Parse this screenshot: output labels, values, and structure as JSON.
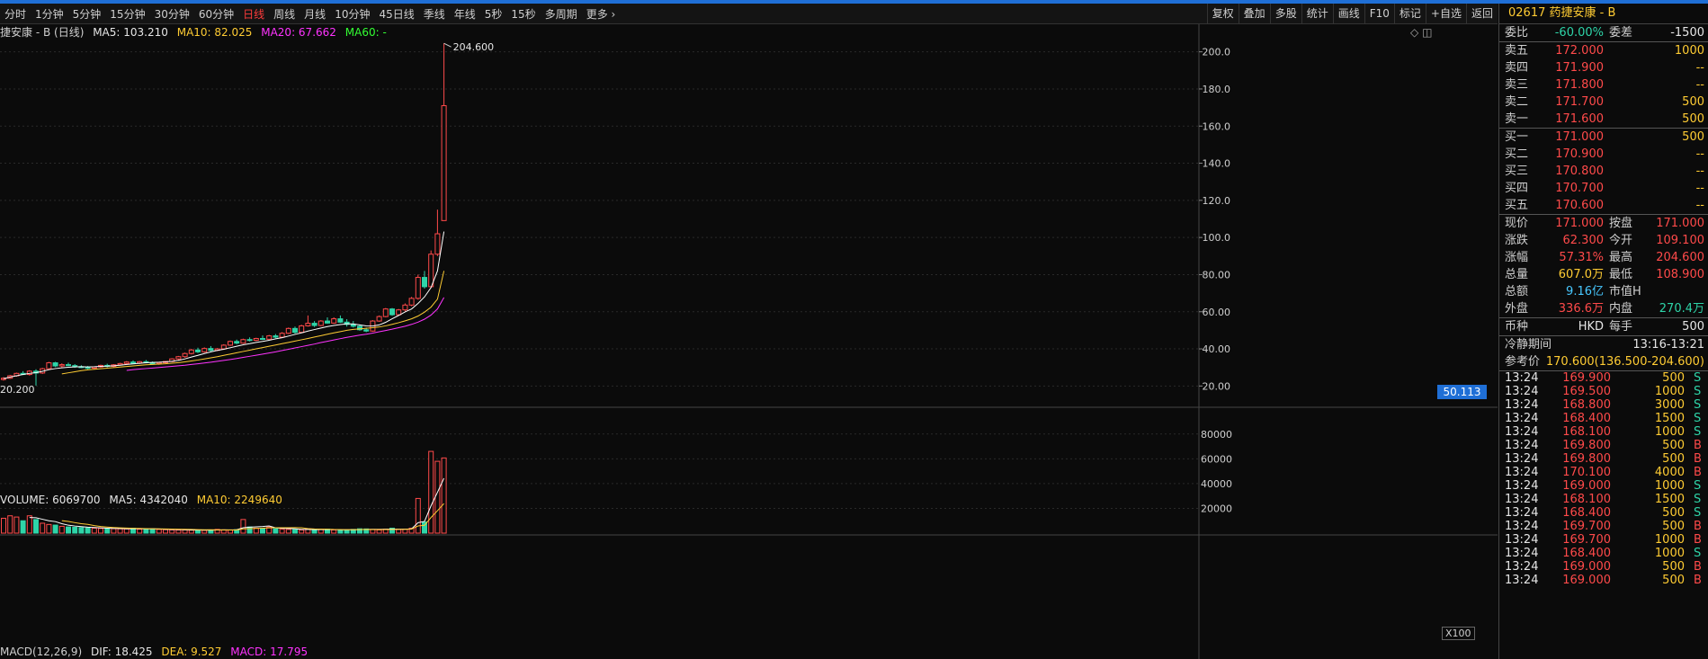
{
  "toolbar": {
    "left": [
      "分时",
      "1分钟",
      "5分钟",
      "15分钟",
      "30分钟",
      "60分钟",
      "日线",
      "周线",
      "月线",
      "10分钟",
      "45日线",
      "季线",
      "年线",
      "5秒",
      "15秒",
      "多周期",
      "更多 ›"
    ],
    "active": "日线",
    "right": [
      "复权",
      "叠加",
      "多股",
      "统计",
      "画线",
      "F10",
      "标记",
      "+自选",
      "返回"
    ]
  },
  "info": {
    "name": "捷安康 - B (日线)",
    "ma5": "MA5: 103.210",
    "ma10": "MA10: 82.025",
    "ma20": "MA20: 67.662",
    "ma60": "MA60: -"
  },
  "volume_info": {
    "vol": "VOLUME: 6069700",
    "ma5": "MA5: 4342040",
    "ma10": "MA10: 2249640"
  },
  "macd_info": {
    "label": "MACD(12,26,9)",
    "dif": "DIF: 18.425",
    "dea": "DEA: 9.527",
    "macd": "MACD: 17.795"
  },
  "colors": {
    "up": "#ff4a4a",
    "down": "#2ed4a8",
    "ma5": "#ffffff",
    "ma10": "#ffcc33",
    "ma20": "#ff33ff",
    "ma60": "#33ff33",
    "accent": "#1f6fd6"
  },
  "chart_data": {
    "type": "candlestick",
    "price_axis": {
      "ticks": [
        "200.0",
        "180.0",
        "160.0",
        "140.0",
        "120.0",
        "100.0",
        "80.00",
        "60.00",
        "40.00",
        "20.00"
      ],
      "ylim": [
        10,
        210
      ]
    },
    "high_label": "204.600",
    "low_label": "20.200",
    "current_price_label": "50.113",
    "volume_axis": {
      "ticks": [
        "80000",
        "60000",
        "40000",
        "20000"
      ],
      "ylim": [
        0,
        90000
      ],
      "unit": "X100"
    },
    "candles": [
      [
        23.5,
        24.8,
        22.9,
        24.2
      ],
      [
        24.2,
        26.0,
        23.8,
        25.5
      ],
      [
        25.5,
        27.2,
        25.0,
        26.8
      ],
      [
        26.8,
        28.0,
        25.9,
        26.2
      ],
      [
        26.2,
        28.5,
        25.6,
        28.0
      ],
      [
        28.0,
        29.0,
        20.2,
        27.0
      ],
      [
        27.0,
        29.8,
        26.5,
        29.3
      ],
      [
        29.3,
        33.0,
        28.8,
        32.5
      ],
      [
        32.5,
        33.0,
        30.2,
        30.8
      ],
      [
        30.8,
        32.2,
        30.0,
        31.5
      ],
      [
        31.5,
        32.6,
        30.7,
        31.0
      ],
      [
        31.0,
        31.8,
        29.8,
        30.4
      ],
      [
        30.4,
        31.2,
        29.6,
        30.0
      ],
      [
        30.0,
        30.8,
        29.0,
        29.6
      ],
      [
        29.6,
        30.6,
        29.0,
        30.3
      ],
      [
        30.3,
        31.5,
        29.8,
        31.1
      ],
      [
        31.1,
        32.0,
        30.0,
        30.6
      ],
      [
        30.6,
        31.8,
        30.2,
        31.4
      ],
      [
        31.4,
        32.5,
        31.0,
        32.1
      ],
      [
        32.1,
        33.4,
        31.6,
        32.9
      ],
      [
        32.9,
        33.8,
        31.9,
        32.3
      ],
      [
        32.3,
        33.5,
        31.8,
        33.1
      ],
      [
        33.1,
        34.0,
        32.2,
        32.6
      ],
      [
        32.6,
        33.2,
        31.5,
        32.0
      ],
      [
        32.0,
        33.0,
        31.4,
        32.6
      ],
      [
        32.6,
        33.5,
        32.0,
        33.2
      ],
      [
        33.2,
        35.0,
        32.8,
        34.6
      ],
      [
        34.6,
        36.2,
        34.0,
        35.8
      ],
      [
        35.8,
        38.0,
        35.2,
        37.5
      ],
      [
        37.5,
        40.0,
        37.0,
        39.4
      ],
      [
        39.4,
        40.6,
        37.8,
        38.4
      ],
      [
        38.4,
        40.8,
        38.0,
        40.2
      ],
      [
        40.2,
        41.5,
        38.6,
        39.2
      ],
      [
        39.2,
        40.5,
        38.8,
        40.0
      ],
      [
        40.0,
        42.5,
        39.5,
        42.0
      ],
      [
        42.0,
        44.5,
        41.6,
        44.0
      ],
      [
        44.0,
        45.0,
        42.5,
        43.1
      ],
      [
        43.1,
        45.5,
        42.8,
        45.0
      ],
      [
        45.0,
        46.2,
        44.0,
        44.6
      ],
      [
        44.6,
        46.0,
        44.2,
        45.6
      ],
      [
        45.6,
        47.2,
        44.8,
        45.2
      ],
      [
        45.2,
        47.5,
        44.9,
        47.0
      ],
      [
        47.0,
        48.0,
        45.8,
        46.3
      ],
      [
        46.3,
        49.0,
        46.0,
        48.4
      ],
      [
        48.4,
        51.5,
        48.0,
        51.0
      ],
      [
        51.0,
        52.0,
        48.2,
        48.9
      ],
      [
        48.9,
        53.0,
        48.5,
        52.4
      ],
      [
        52.4,
        58.0,
        52.0,
        53.8
      ],
      [
        53.8,
        55.0,
        51.8,
        52.6
      ],
      [
        52.6,
        55.5,
        52.2,
        55.0
      ],
      [
        55.0,
        57.0,
        53.5,
        53.9
      ],
      [
        53.9,
        57.0,
        53.5,
        56.2
      ],
      [
        56.2,
        58.0,
        54.0,
        54.4
      ],
      [
        54.4,
        56.0,
        52.0,
        53.2
      ],
      [
        53.2,
        55.0,
        51.5,
        52.2
      ],
      [
        52.2,
        53.0,
        49.8,
        50.3
      ],
      [
        50.3,
        51.5,
        49.0,
        49.6
      ],
      [
        49.6,
        55.5,
        49.2,
        55.0
      ],
      [
        55.0,
        58.0,
        54.6,
        57.4
      ],
      [
        57.4,
        62.0,
        57.0,
        61.5
      ],
      [
        61.5,
        62.0,
        57.8,
        58.4
      ],
      [
        58.4,
        61.5,
        58.0,
        61.0
      ],
      [
        61.0,
        64.5,
        60.2,
        63.6
      ],
      [
        63.6,
        68.0,
        63.0,
        67.2
      ],
      [
        67.2,
        80.0,
        66.5,
        78.5
      ],
      [
        78.5,
        82.0,
        72.5,
        73.5
      ],
      [
        73.5,
        93.0,
        73.0,
        91.0
      ],
      [
        91.0,
        115.0,
        90.0,
        102.0
      ],
      [
        109.1,
        204.6,
        108.9,
        171.0
      ]
    ],
    "ma5": [
      24,
      24.8,
      25.5,
      26.2,
      26.8,
      27.2,
      27.9,
      28.8,
      29.4,
      29.8,
      30.1,
      30.3,
      30.4,
      30.3,
      30.4,
      30.6,
      30.7,
      30.9,
      31.2,
      31.6,
      31.9,
      32.2,
      32.5,
      32.7,
      32.8,
      33.0,
      33.3,
      33.8,
      34.6,
      35.6,
      36.5,
      37.5,
      38.4,
      39.2,
      39.8,
      40.6,
      41.4,
      42.2,
      42.8,
      43.5,
      44.0,
      44.6,
      45.4,
      46.0,
      46.9,
      47.8,
      48.6,
      49.6,
      50.4,
      51.2,
      52.0,
      52.6,
      53.1,
      53.5,
      53.4,
      52.9,
      52.4,
      52.3,
      52.9,
      54.3,
      56.2,
      58.0,
      59.9,
      61.5,
      64.5,
      68.0,
      73.0,
      82.0,
      103.2
    ],
    "ma10": [
      null,
      null,
      null,
      null,
      null,
      null,
      null,
      null,
      null,
      26.5,
      27.1,
      27.7,
      28.3,
      28.7,
      29.0,
      29.3,
      29.6,
      29.9,
      30.2,
      30.5,
      30.8,
      31.1,
      31.4,
      31.6,
      31.8,
      32.0,
      32.3,
      32.6,
      33.0,
      33.5,
      34.0,
      34.6,
      35.2,
      35.8,
      36.5,
      37.2,
      37.9,
      38.6,
      39.3,
      40.0,
      40.7,
      41.4,
      42.1,
      42.8,
      43.5,
      44.2,
      44.9,
      45.6,
      46.4,
      47.1,
      47.9,
      48.6,
      49.3,
      50.0,
      50.5,
      50.8,
      51.1,
      51.4,
      51.8,
      52.4,
      53.2,
      54.1,
      55.1,
      56.2,
      57.7,
      59.8,
      62.5,
      66.8,
      82.0
    ],
    "ma20": [
      null,
      null,
      null,
      null,
      null,
      null,
      null,
      null,
      null,
      null,
      null,
      null,
      null,
      null,
      null,
      null,
      null,
      null,
      null,
      28.4,
      28.8,
      29.1,
      29.4,
      29.7,
      30.0,
      30.3,
      30.6,
      30.9,
      31.2,
      31.6,
      32.0,
      32.4,
      32.8,
      33.3,
      33.8,
      34.3,
      34.8,
      35.4,
      36.0,
      36.6,
      37.2,
      37.8,
      38.4,
      39.1,
      39.8,
      40.5,
      41.2,
      41.9,
      42.6,
      43.4,
      44.1,
      44.8,
      45.5,
      46.2,
      46.8,
      47.4,
      47.9,
      48.5,
      49.2,
      49.9,
      50.6,
      51.4,
      52.2,
      53.2,
      54.4,
      56.0,
      58.2,
      61.5,
      67.7
    ],
    "volume": [
      12000,
      14000,
      13000,
      10000,
      14000,
      11000,
      8000,
      7000,
      6500,
      5500,
      5000,
      4800,
      4500,
      4200,
      4000,
      3800,
      3600,
      3600,
      3500,
      3400,
      4000,
      3200,
      3000,
      3600,
      3000,
      2800,
      2600,
      2500,
      2600,
      2400,
      2500,
      2300,
      2600,
      3000,
      2600,
      2500,
      2800,
      11000,
      5000,
      4000,
      3800,
      5000,
      3500,
      3200,
      3000,
      2800,
      2600,
      3400,
      2500,
      3000,
      3200,
      2600,
      2500,
      2400,
      3000,
      3500,
      3400,
      3000,
      2600,
      3200,
      4000,
      3000,
      3200,
      4000,
      28000,
      9000,
      66000,
      58000,
      60697
    ]
  },
  "side": {
    "title": "02617 药捷安康 - B",
    "weibi_label": "委比",
    "weibi_value": "-60.00%",
    "weicha_label": "委差",
    "weicha_value": "-1500",
    "asks": [
      {
        "label": "卖五",
        "price": "172.000",
        "vol": "1000"
      },
      {
        "label": "卖四",
        "price": "171.900",
        "vol": "--"
      },
      {
        "label": "卖三",
        "price": "171.800",
        "vol": "--"
      },
      {
        "label": "卖二",
        "price": "171.700",
        "vol": "500"
      },
      {
        "label": "卖一",
        "price": "171.600",
        "vol": "500"
      }
    ],
    "bids": [
      {
        "label": "买一",
        "price": "171.000",
        "vol": "500"
      },
      {
        "label": "买二",
        "price": "170.900",
        "vol": "--"
      },
      {
        "label": "买三",
        "price": "170.800",
        "vol": "--"
      },
      {
        "label": "买四",
        "price": "170.700",
        "vol": "--"
      },
      {
        "label": "买五",
        "price": "170.600",
        "vol": "--"
      }
    ],
    "stats": [
      {
        "l1": "现价",
        "v1": "171.000",
        "c1": "red",
        "l2": "按盘",
        "v2": "171.000",
        "c2": "red"
      },
      {
        "l1": "涨跌",
        "v1": "62.300",
        "c1": "red",
        "l2": "今开",
        "v2": "109.100",
        "c2": "red"
      },
      {
        "l1": "涨幅",
        "v1": "57.31%",
        "c1": "red",
        "l2": "最高",
        "v2": "204.600",
        "c2": "red"
      },
      {
        "l1": "总量",
        "v1": "607.0万",
        "c1": "yellow",
        "l2": "最低",
        "v2": "108.900",
        "c2": "red"
      },
      {
        "l1": "总额",
        "v1": "9.16亿",
        "c1": "cyan",
        "l2": "市值H",
        "v2": "",
        "c2": "white"
      },
      {
        "l1": "外盘",
        "v1": "336.6万",
        "c1": "red",
        "l2": "内盘",
        "v2": "270.4万",
        "c2": "green"
      }
    ],
    "currency_label": "币种",
    "currency_value": "HKD",
    "lot_label": "每手",
    "lot_value": "500",
    "cooling_label": "冷静期间",
    "cooling_value": "13:16-13:21",
    "ref_label": "参考价",
    "ref_value": "170.600(136.500-204.600)",
    "ticks": [
      {
        "t": "13:24",
        "p": "169.900",
        "v": "500",
        "s": "S"
      },
      {
        "t": "13:24",
        "p": "169.500",
        "v": "1000",
        "s": "S"
      },
      {
        "t": "13:24",
        "p": "168.800",
        "v": "3000",
        "s": "S"
      },
      {
        "t": "13:24",
        "p": "168.400",
        "v": "1500",
        "s": "S"
      },
      {
        "t": "13:24",
        "p": "168.100",
        "v": "1000",
        "s": "S"
      },
      {
        "t": "13:24",
        "p": "169.800",
        "v": "500",
        "s": "B"
      },
      {
        "t": "13:24",
        "p": "169.800",
        "v": "500",
        "s": "B"
      },
      {
        "t": "13:24",
        "p": "170.100",
        "v": "4000",
        "s": "B"
      },
      {
        "t": "13:24",
        "p": "169.000",
        "v": "1000",
        "s": "S"
      },
      {
        "t": "13:24",
        "p": "168.100",
        "v": "1500",
        "s": "S"
      },
      {
        "t": "13:24",
        "p": "168.400",
        "v": "500",
        "s": "S"
      },
      {
        "t": "13:24",
        "p": "169.700",
        "v": "500",
        "s": "B"
      },
      {
        "t": "13:24",
        "p": "169.700",
        "v": "1000",
        "s": "B"
      },
      {
        "t": "13:24",
        "p": "168.400",
        "v": "1000",
        "s": "S"
      },
      {
        "t": "13:24",
        "p": "169.000",
        "v": "500",
        "s": "B"
      },
      {
        "t": "13:24",
        "p": "169.000",
        "v": "500",
        "s": "B"
      }
    ]
  }
}
